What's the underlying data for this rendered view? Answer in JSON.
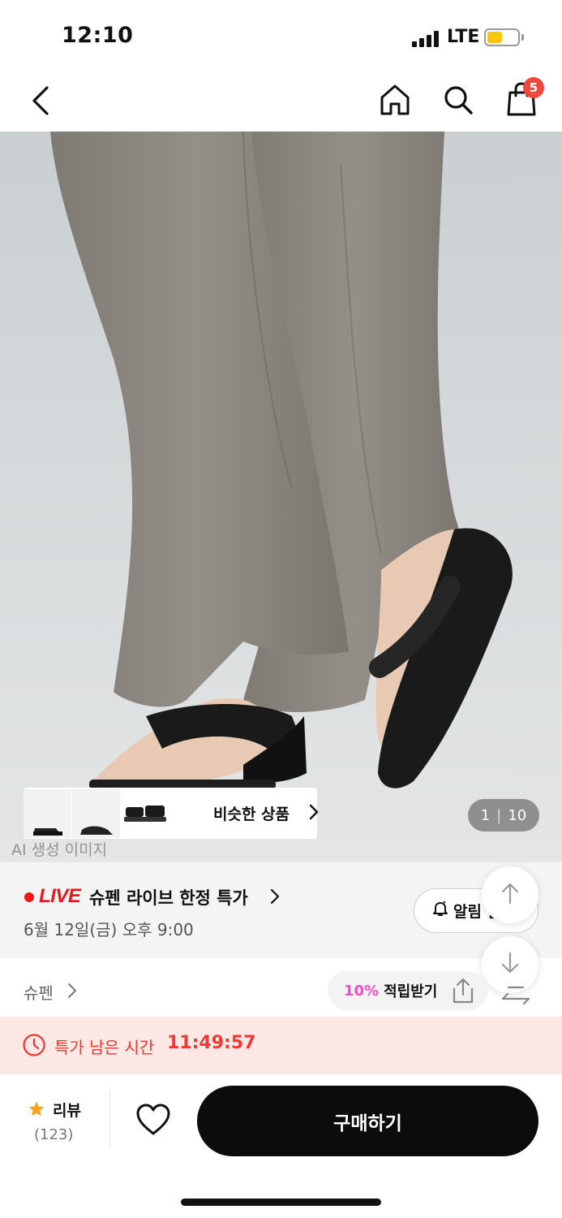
{
  "status_bar": {
    "time": "12:10",
    "network": "LTE",
    "battery_fill": 0.5
  },
  "nav": {
    "cart_badge": "5",
    "icons": [
      "back-chevron-icon",
      "home-icon",
      "search-icon",
      "shopping-bag-icon"
    ]
  },
  "gallery": {
    "similar_label": "비슷한 상품",
    "page_current": "1",
    "page_total": "10",
    "ai_caption": "AI 생성 이미지"
  },
  "live": {
    "badge": "LIVE",
    "title": "슈펜 라이브 한정 특가",
    "date": "6월 12일(금) 오후 9:00",
    "alarm_label": "알림 받기"
  },
  "brand": {
    "name": "슈펜",
    "points_percent": "10%",
    "points_label": "적립받기"
  },
  "timer": {
    "label": "특가 남은 시간",
    "value": "11:49:57"
  },
  "bottom": {
    "review_label": "리뷰",
    "review_count": "(123)",
    "buy_label": "구매하기"
  },
  "colors": {
    "accent_red": "#ee3a35",
    "live_red": "#e8181b",
    "points_pink": "#f04ec2",
    "badge_red": "#f0483e",
    "battery_yellow": "#f7c60d",
    "star_orange": "#f7a51c"
  }
}
